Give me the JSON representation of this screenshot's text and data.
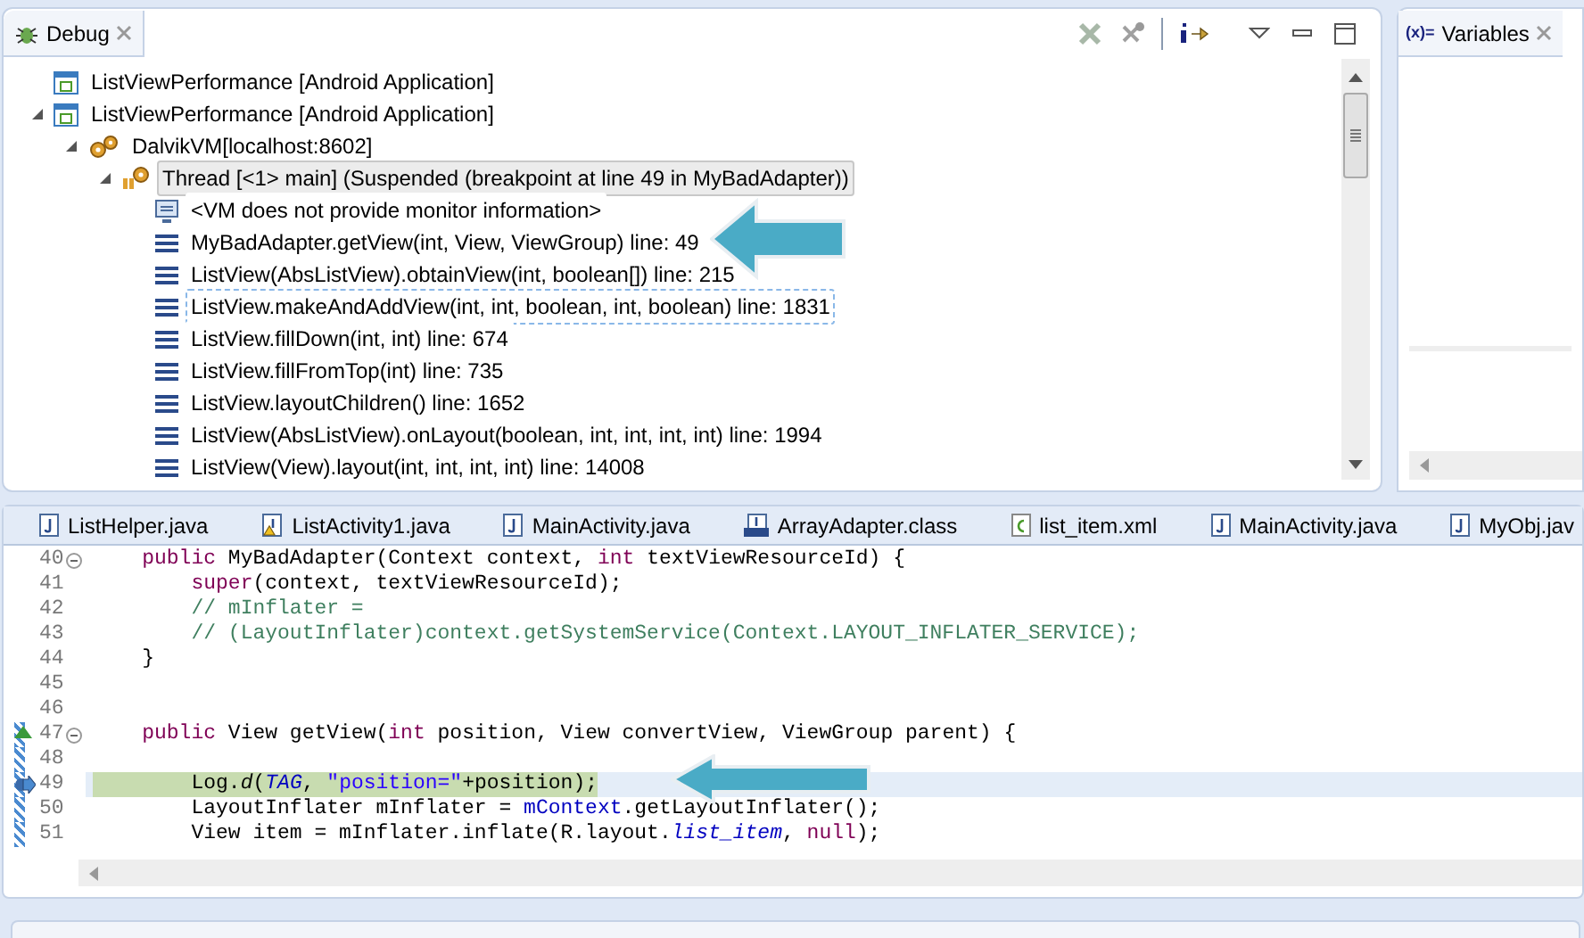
{
  "debug": {
    "title": "Debug",
    "tree": [
      {
        "kind": "launch",
        "label": "ListViewPerformance [Android Application]",
        "selected": false,
        "focused": false
      },
      {
        "kind": "launch",
        "label": "ListViewPerformance [Android Application]",
        "selected": false,
        "focused": false,
        "expanded": true,
        "children": [
          {
            "kind": "vm",
            "label": "DalvikVM[localhost:8602]",
            "selected": false,
            "focused": false,
            "expanded": true,
            "children": [
              {
                "kind": "thread",
                "label": "Thread [<1> main] (Suspended (breakpoint at line 49 in MyBadAdapter))",
                "selected": true,
                "focused": false,
                "expanded": true,
                "children": [
                  {
                    "kind": "monitor",
                    "label": "<VM does not provide monitor information>",
                    "selected": false,
                    "focused": false
                  },
                  {
                    "kind": "frame",
                    "label": "MyBadAdapter.getView(int, View, ViewGroup) line: 49",
                    "selected": false,
                    "focused": false
                  },
                  {
                    "kind": "frame",
                    "label": "ListView(AbsListView).obtainView(int, boolean[]) line: 215",
                    "selected": false,
                    "focused": false
                  },
                  {
                    "kind": "frame",
                    "label": "ListView.makeAndAddView(int, int, boolean, int, boolean) line: 1831",
                    "selected": false,
                    "focused": true
                  },
                  {
                    "kind": "frame",
                    "label": "ListView.fillDown(int, int) line: 674",
                    "selected": false,
                    "focused": false
                  },
                  {
                    "kind": "frame",
                    "label": "ListView.fillFromTop(int) line: 735",
                    "selected": false,
                    "focused": false
                  },
                  {
                    "kind": "frame",
                    "label": "ListView.layoutChildren() line: 1652",
                    "selected": false,
                    "focused": false
                  },
                  {
                    "kind": "frame",
                    "label": "ListView(AbsListView).onLayout(boolean, int, int, int, int) line: 1994",
                    "selected": false,
                    "focused": false
                  },
                  {
                    "kind": "frame",
                    "label": "ListView(View).layout(int, int, int, int) line: 14008",
                    "selected": false,
                    "focused": false
                  }
                ]
              }
            ]
          }
        ]
      }
    ]
  },
  "variables": {
    "title": "Variables",
    "icon_text": "(x)="
  },
  "editor": {
    "tabs": [
      {
        "label": "ListHelper.java",
        "kind": "java"
      },
      {
        "label": "ListActivity1.java",
        "kind": "java-warning"
      },
      {
        "label": "MainActivity.java",
        "kind": "java"
      },
      {
        "label": "ArrayAdapter.class",
        "kind": "class"
      },
      {
        "label": "list_item.xml",
        "kind": "xml"
      },
      {
        "label": "MainActivity.java",
        "kind": "java"
      },
      {
        "label": "MyObj.jav",
        "kind": "java"
      }
    ],
    "lines": [
      {
        "number": "40",
        "foldable": true,
        "range": false,
        "current": false,
        "breakpoint": false,
        "instruction_pointer": false,
        "tokens": [
          {
            "text": "    public",
            "kind": "keyword"
          },
          {
            "text": " MyBadAdapter(Context context, ",
            "kind": "plain"
          },
          {
            "text": "int",
            "kind": "keyword"
          },
          {
            "text": " textViewResourceId) {",
            "kind": "plain"
          }
        ]
      },
      {
        "number": "41",
        "foldable": false,
        "range": false,
        "current": false,
        "breakpoint": false,
        "instruction_pointer": false,
        "tokens": [
          {
            "text": "        super",
            "kind": "keyword"
          },
          {
            "text": "(context, textViewResourceId);",
            "kind": "plain"
          }
        ]
      },
      {
        "number": "42",
        "foldable": false,
        "range": false,
        "current": false,
        "breakpoint": false,
        "instruction_pointer": false,
        "tokens": [
          {
            "text": "        // mInflater =",
            "kind": "comment"
          }
        ]
      },
      {
        "number": "43",
        "foldable": false,
        "range": false,
        "current": false,
        "breakpoint": false,
        "instruction_pointer": false,
        "tokens": [
          {
            "text": "        // (LayoutInflater)context.getSystemService(Context.LAYOUT_INFLATER_SERVICE);",
            "kind": "comment"
          }
        ]
      },
      {
        "number": "44",
        "foldable": false,
        "range": false,
        "current": false,
        "breakpoint": false,
        "instruction_pointer": false,
        "tokens": [
          {
            "text": "    }",
            "kind": "plain"
          }
        ]
      },
      {
        "number": "45",
        "foldable": false,
        "range": false,
        "current": false,
        "breakpoint": false,
        "instruction_pointer": false
      },
      {
        "number": "46",
        "foldable": false,
        "range": false,
        "current": false,
        "breakpoint": false,
        "instruction_pointer": false
      },
      {
        "number": "47",
        "foldable": true,
        "range": true,
        "current": false,
        "breakpoint": true,
        "instruction_pointer": false,
        "tokens": [
          {
            "text": "    public",
            "kind": "keyword"
          },
          {
            "text": " View getView(",
            "kind": "plain"
          },
          {
            "text": "int",
            "kind": "keyword"
          },
          {
            "text": " position, View convertView, ViewGroup parent) {",
            "kind": "plain"
          }
        ]
      },
      {
        "number": "48",
        "foldable": false,
        "range": true,
        "current": false,
        "breakpoint": false,
        "instruction_pointer": false
      },
      {
        "number": "49",
        "foldable": false,
        "range": true,
        "current": true,
        "breakpoint": false,
        "instruction_pointer": true,
        "tokens": [
          {
            "text": "        Log.",
            "kind": "plain"
          },
          {
            "text": "d",
            "kind": "static-method"
          },
          {
            "text": "(",
            "kind": "plain"
          },
          {
            "text": "TAG",
            "kind": "static-field"
          },
          {
            "text": ", ",
            "kind": "plain"
          },
          {
            "text": "\"position=\"",
            "kind": "string"
          },
          {
            "text": "+position);",
            "kind": "plain"
          }
        ]
      },
      {
        "number": "50",
        "foldable": false,
        "range": true,
        "current": false,
        "breakpoint": false,
        "instruction_pointer": false,
        "tokens": [
          {
            "text": "        LayoutInflater mInflater = ",
            "kind": "plain"
          },
          {
            "text": "mContext",
            "kind": "field"
          },
          {
            "text": ".getLayoutInflater();",
            "kind": "plain"
          }
        ]
      },
      {
        "number": "51",
        "foldable": false,
        "range": true,
        "current": false,
        "breakpoint": false,
        "instruction_pointer": false,
        "tokens": [
          {
            "text": "        View item = mInflater.inflate(R.layout.",
            "kind": "plain"
          },
          {
            "text": "list_item",
            "kind": "static-field"
          },
          {
            "text": ", ",
            "kind": "plain"
          },
          {
            "text": "null",
            "kind": "keyword"
          },
          {
            "text": ");",
            "kind": "plain"
          }
        ]
      }
    ]
  }
}
